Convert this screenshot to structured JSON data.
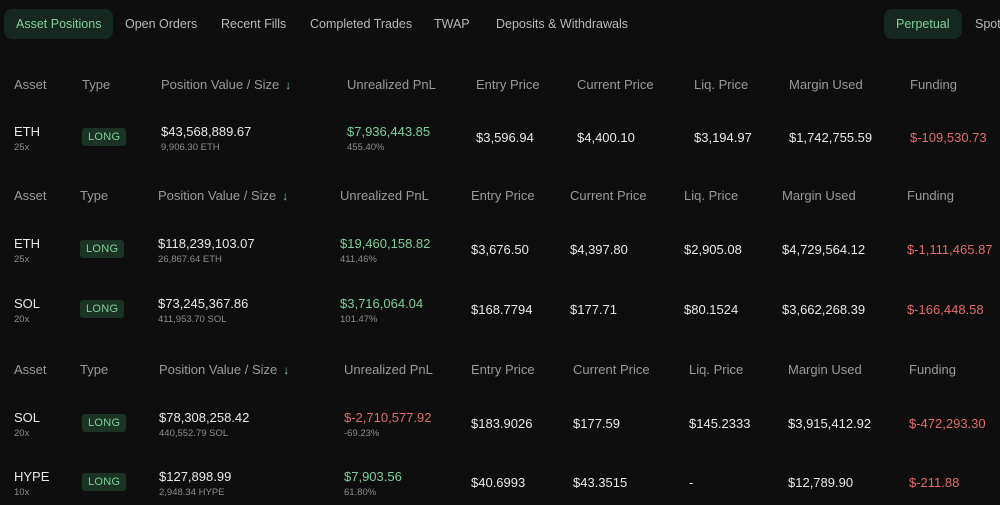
{
  "tabs": {
    "asset_positions": "Asset Positions",
    "open_orders": "Open Orders",
    "recent_fills": "Recent Fills",
    "completed_trades": "Completed Trades",
    "twap": "TWAP",
    "deposits_withdrawals": "Deposits & Withdrawals"
  },
  "market_toggle": {
    "perpetual": "Perpetual",
    "spot": "Spot"
  },
  "columns": {
    "asset": "Asset",
    "type": "Type",
    "position_value": "Position Value / Size",
    "unrealized_pnl": "Unrealized PnL",
    "entry_price": "Entry Price",
    "current_price": "Current Price",
    "liq_price": "Liq. Price",
    "margin_used": "Margin Used",
    "funding": "Funding"
  },
  "tables": [
    {
      "rows": [
        {
          "asset": "ETH",
          "leverage": "25x",
          "type": "LONG",
          "value": "$43,568,889.67",
          "size": "9,906.30 ETH",
          "pnl": "$7,936,443.85",
          "pnl_pct": "455.40%",
          "pnl_positive": true,
          "entry": "$3,596.94",
          "current": "$4,400.10",
          "liq": "$3,194.97",
          "margin": "$1,742,755.59",
          "funding": "$-109,530.73"
        }
      ]
    },
    {
      "rows": [
        {
          "asset": "ETH",
          "leverage": "25x",
          "type": "LONG",
          "value": "$118,239,103.07",
          "size": "26,867.64 ETH",
          "pnl": "$19,460,158.82",
          "pnl_pct": "411.46%",
          "pnl_positive": true,
          "entry": "$3,676.50",
          "current": "$4,397.80",
          "liq": "$2,905.08",
          "margin": "$4,729,564.12",
          "funding": "$-1,111,465.87"
        },
        {
          "asset": "SOL",
          "leverage": "20x",
          "type": "LONG",
          "value": "$73,245,367.86",
          "size": "411,953.70 SOL",
          "pnl": "$3,716,064.04",
          "pnl_pct": "101.47%",
          "pnl_positive": true,
          "entry": "$168.7794",
          "current": "$177.71",
          "liq": "$80.1524",
          "margin": "$3,662,268.39",
          "funding": "$-166,448.58"
        }
      ]
    },
    {
      "rows": [
        {
          "asset": "SOL",
          "leverage": "20x",
          "type": "LONG",
          "value": "$78,308,258.42",
          "size": "440,552.79 SOL",
          "pnl": "$-2,710,577.92",
          "pnl_pct": "-69.23%",
          "pnl_positive": false,
          "entry": "$183.9026",
          "current": "$177.59",
          "liq": "$145.2333",
          "margin": "$3,915,412.92",
          "funding": "$-472,293.30"
        },
        {
          "asset": "HYPE",
          "leverage": "10x",
          "type": "LONG",
          "value": "$127,898.99",
          "size": "2,948.34 HYPE",
          "pnl": "$7,903.56",
          "pnl_pct": "61.80%",
          "pnl_positive": true,
          "entry": "$40.6993",
          "current": "$43.3515",
          "liq": "-",
          "margin": "$12,789.90",
          "funding": "$-211.88"
        }
      ]
    }
  ]
}
